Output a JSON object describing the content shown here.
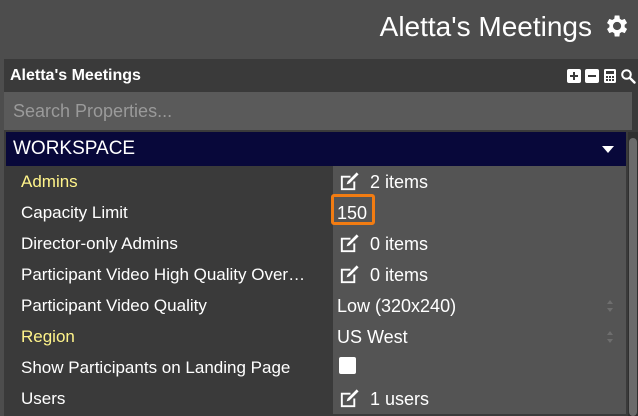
{
  "app": {
    "title": "Aletta's Meetings",
    "settings_icon": "gear-icon"
  },
  "panel": {
    "title": "Aletta's Meetings",
    "tools": [
      "plus-square-icon",
      "minus-square-icon",
      "calculator-icon",
      "search-icon"
    ]
  },
  "search": {
    "placeholder": "Search Properties...",
    "value": ""
  },
  "section": {
    "label": "WORKSPACE",
    "expanded": true
  },
  "rows": [
    {
      "label": "Admins",
      "value": "2 items",
      "kind": "items",
      "label_color": "#fff48a"
    },
    {
      "label": "Capacity Limit",
      "value": "150",
      "kind": "number",
      "label_color": "#ffffff",
      "highlighted": true
    },
    {
      "label": "Director-only Admins",
      "value": "0 items",
      "kind": "items",
      "label_color": "#ffffff"
    },
    {
      "label": "Participant Video High Quality Over…",
      "value": "0 items",
      "kind": "items",
      "label_color": "#ffffff"
    },
    {
      "label": "Participant Video Quality",
      "value": "Low (320x240)",
      "kind": "select",
      "label_color": "#ffffff"
    },
    {
      "label": "Region",
      "value": "US West",
      "kind": "select",
      "label_color": "#fff48a"
    },
    {
      "label": "Show Participants on Landing Page",
      "value": "",
      "kind": "checkbox",
      "checked": false,
      "label_color": "#ffffff"
    },
    {
      "label": "Users",
      "value": "1 users",
      "kind": "items",
      "label_color": "#ffffff"
    }
  ],
  "colors": {
    "background": "#4d4d4d",
    "panel": "#3a3a3a",
    "section_header": "#08083a",
    "highlight": "#f27c12",
    "required_label": "#fff48a"
  }
}
